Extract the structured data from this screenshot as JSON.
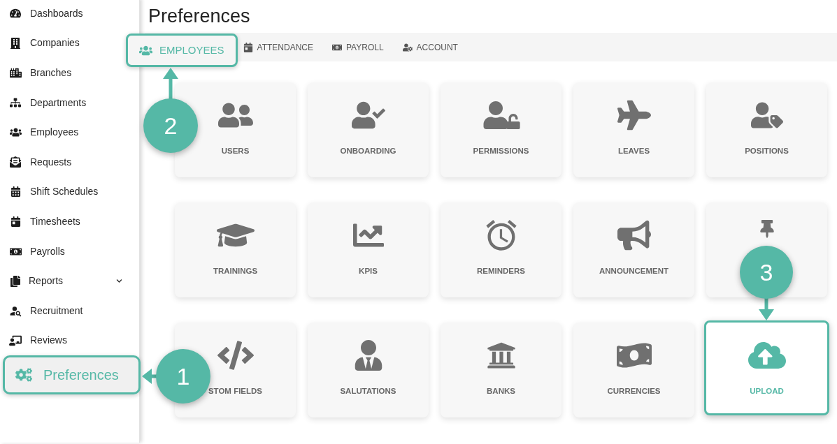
{
  "sidebar": {
    "items": [
      {
        "label": "Dashboards",
        "kind": "link",
        "selected": false
      },
      {
        "label": "Companies",
        "kind": "link",
        "selected": false
      },
      {
        "label": "Branches",
        "kind": "link",
        "selected": false
      },
      {
        "label": "Departments",
        "kind": "link",
        "selected": false
      },
      {
        "label": "Employees",
        "kind": "link",
        "selected": false
      },
      {
        "label": "Requests",
        "kind": "link",
        "selected": false
      },
      {
        "label": "Shift Schedules",
        "kind": "link",
        "selected": false
      },
      {
        "label": "Timesheets",
        "kind": "link",
        "selected": false
      },
      {
        "label": "Payrolls",
        "kind": "link",
        "selected": false
      },
      {
        "label": "Reports",
        "kind": "group",
        "expanded": false,
        "selected": false
      },
      {
        "label": "Recruitment",
        "kind": "link",
        "selected": false
      },
      {
        "label": "Reviews",
        "kind": "link",
        "selected": false
      },
      {
        "label": "Preferences",
        "kind": "link",
        "selected": true
      }
    ]
  },
  "page": {
    "title": "Preferences"
  },
  "tabs": [
    {
      "label": "EMPLOYEES",
      "selected": true
    },
    {
      "label": "ATTENDANCE",
      "selected": false
    },
    {
      "label": "PAYROLL",
      "selected": false
    },
    {
      "label": "ACCOUNT",
      "selected": false
    }
  ],
  "tiles": [
    {
      "label": "USERS",
      "selected": false
    },
    {
      "label": "ONBOARDING",
      "selected": false
    },
    {
      "label": "PERMISSIONS",
      "selected": false
    },
    {
      "label": "LEAVES",
      "selected": false
    },
    {
      "label": "POSITIONS",
      "selected": false
    },
    {
      "label": "TRAININGS",
      "selected": false
    },
    {
      "label": "KPIS",
      "selected": false
    },
    {
      "label": "REMINDERS",
      "selected": false
    },
    {
      "label": "ANNOUNCEMENT",
      "selected": false
    },
    {
      "selected": false
    },
    {
      "label": "STOM FIELDS",
      "selected": false
    },
    {
      "label": "SALUTATIONS",
      "selected": false
    },
    {
      "label": "BANKS",
      "selected": false
    },
    {
      "label": "CURRENCIES",
      "selected": false
    },
    {
      "label": "UPLOAD",
      "selected": true
    }
  ],
  "callouts": [
    {
      "number": "1"
    },
    {
      "number": "2"
    },
    {
      "number": "3"
    }
  ]
}
